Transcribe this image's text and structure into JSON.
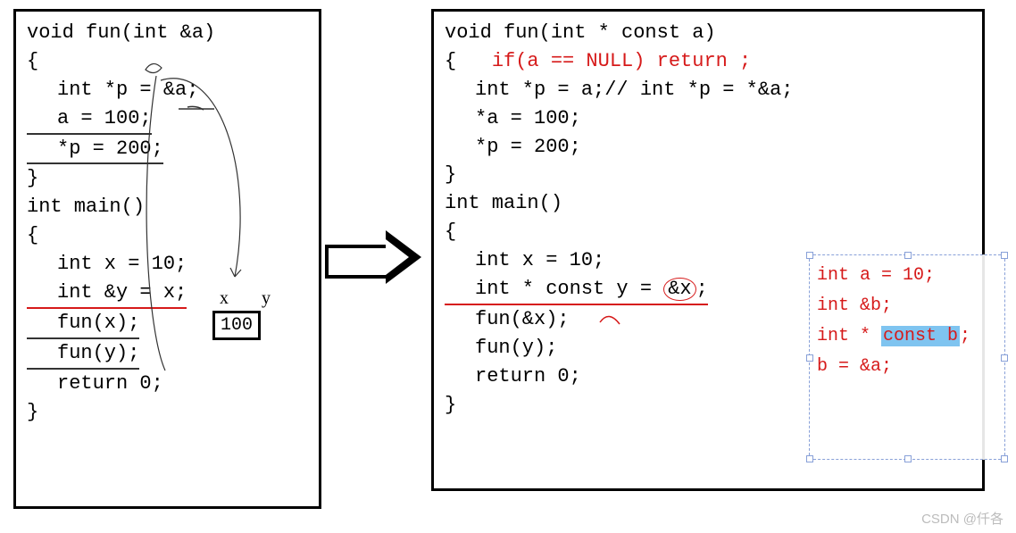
{
  "left": {
    "l1": "void fun(int &a)",
    "l2": "{",
    "l3": "int *p = &a;",
    "l4": "a = 100;",
    "l5": "*p = 200;",
    "l6": "}",
    "l7": "int main()",
    "l8": "{",
    "l9": "int x = 10;",
    "l10": "int &y = x;",
    "l11": "fun(x);",
    "l12": "fun(y);",
    "l13": "return 0;",
    "l14": "}"
  },
  "right": {
    "l1": "void fun(int * const a)",
    "l2a": "{",
    "l2b": "if(a == NULL) return ;",
    "l3a": "int *p = a;",
    "l3b": "// int *p = *&a;",
    "l4": "*a = 100;",
    "l5": "*p = 200;",
    "l6": "}",
    "l7": "int main()",
    "l8": "{",
    "l9": "int x = 10;",
    "l10a": "int * const y = ",
    "l10b": "&x",
    "l10c": ";",
    "l11": "fun(&x);",
    "l12": "fun(y);",
    "l13": "return 0;",
    "l14": "}"
  },
  "note": {
    "n1": "int a = 10;",
    "n2": "int &b;",
    "n3a": "int * ",
    "n3b": "const b",
    "n3c": ";",
    "n4": "b = &a;"
  },
  "mem": {
    "x_label": "x",
    "y_label": "y",
    "value": "100"
  },
  "watermark": "CSDN @仟各"
}
